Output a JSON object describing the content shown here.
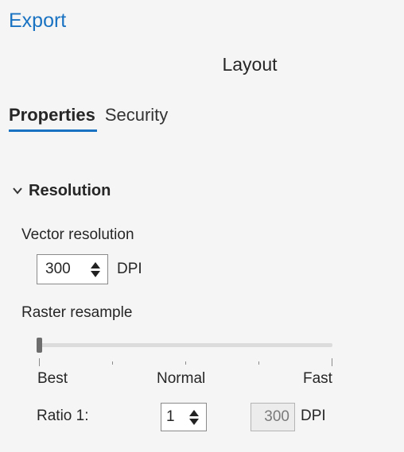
{
  "pane": {
    "title": "Export",
    "subtitle": "Layout"
  },
  "tabs": [
    {
      "label": "Properties",
      "active": true
    },
    {
      "label": "Security",
      "active": false
    }
  ],
  "resolution": {
    "header": "Resolution",
    "vector_label": "Vector resolution",
    "vector_value": "300",
    "vector_unit": "DPI",
    "raster_label": "Raster resample",
    "slider_level": 0,
    "slider_labels": {
      "left": "Best",
      "middle": "Normal",
      "right": "Fast"
    },
    "ratio_label": "Ratio 1:",
    "ratio_value": "1",
    "computed_value": "300",
    "computed_unit": "DPI"
  },
  "colors": {
    "accent": "#1a73c2"
  }
}
